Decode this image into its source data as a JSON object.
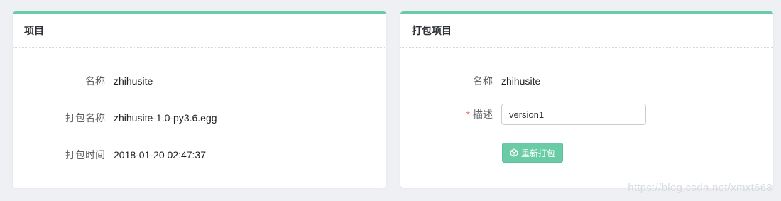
{
  "left_card": {
    "title": "项目",
    "rows": [
      {
        "label": "名称",
        "value": "zhihusite"
      },
      {
        "label": "打包名称",
        "value": "zhihusite-1.0-py3.6.egg"
      },
      {
        "label": "打包时间",
        "value": "2018-01-20 02:47:37"
      }
    ]
  },
  "right_card": {
    "title": "打包项目",
    "name_label": "名称",
    "name_value": "zhihusite",
    "required_mark": "*",
    "desc_label": "描述",
    "desc_value": "version1",
    "repack_button": "重新打包",
    "repack_icon": "cube-icon"
  },
  "watermark": "https://blog.csdn.net/xmxt668",
  "colors": {
    "accent": "#6acca6",
    "background": "#eef0f4",
    "required": "#f56c6c"
  }
}
